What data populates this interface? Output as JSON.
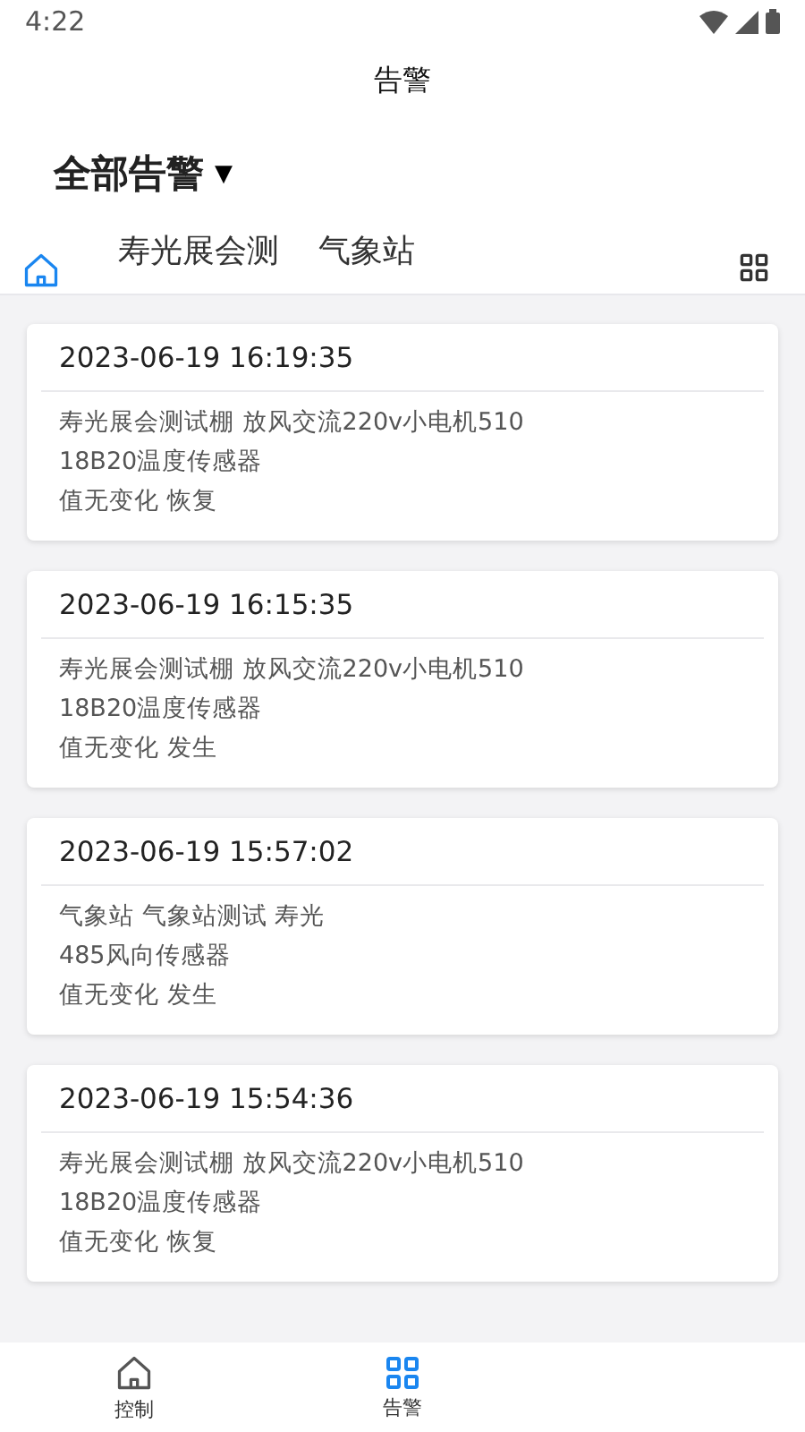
{
  "status_bar": {
    "time": "4:22"
  },
  "header": {
    "title": "告警"
  },
  "filter": {
    "label": "全部告警",
    "caret": "▼"
  },
  "tabs": [
    {
      "kind": "home",
      "selected": true
    },
    {
      "kind": "text",
      "label": "寿光展会测",
      "selected": false
    },
    {
      "kind": "text",
      "label": "气象站",
      "selected": false
    }
  ],
  "alarms": [
    {
      "time": "2023-06-19 16:19:35",
      "lines": [
        "寿光展会测试棚 放风交流220v小电机510",
        "18B20温度传感器",
        "值无变化 恢复"
      ]
    },
    {
      "time": "2023-06-19 16:15:35",
      "lines": [
        "寿光展会测试棚 放风交流220v小电机510",
        "18B20温度传感器",
        "值无变化 发生"
      ]
    },
    {
      "time": "2023-06-19 15:57:02",
      "lines": [
        "气象站 气象站测试 寿光",
        "485风向传感器",
        "值无变化 发生"
      ]
    },
    {
      "time": "2023-06-19 15:54:36",
      "lines": [
        "寿光展会测试棚 放风交流220v小电机510",
        "18B20温度传感器",
        "值无变化 恢复"
      ]
    }
  ],
  "bottom_nav": [
    {
      "kind": "home",
      "label": "控制",
      "selected": false
    },
    {
      "kind": "grid",
      "label": "告警",
      "selected": true
    }
  ]
}
